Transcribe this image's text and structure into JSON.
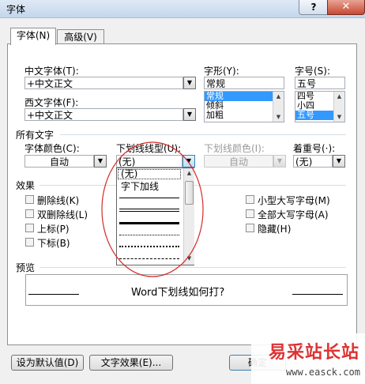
{
  "window": {
    "title": "字体",
    "help_label": "?",
    "close_label": "✕"
  },
  "tabs": [
    {
      "label": "字体(N)"
    },
    {
      "label": "高级(V)"
    }
  ],
  "font": {
    "chinese_label": "中文字体(T):",
    "chinese_value": "+中文正文",
    "western_label": "西文字体(F):",
    "western_value": "+中文正文",
    "style_label": "字形(Y):",
    "style_value": "常规",
    "style_options": [
      "常规",
      "倾斜",
      "加粗"
    ],
    "size_label": "字号(S):",
    "size_value": "五号",
    "size_options": [
      "四号",
      "小四",
      "五号"
    ]
  },
  "all_text": {
    "section_label": "所有文字",
    "color_label": "字体颜色(C):",
    "color_value": "自动",
    "underline_label": "下划线线型(U):",
    "underline_value": "(无)",
    "underline_color_label": "下划线颜色(I):",
    "underline_color_value": "自动",
    "emphasis_label": "着重号(·):",
    "emphasis_value": "(无)"
  },
  "underline_dropdown": {
    "items": [
      "(无)",
      "字下加线"
    ]
  },
  "effects": {
    "section_label": "效果",
    "left": [
      "删除线(K)",
      "双删除线(L)",
      "上标(P)",
      "下标(B)"
    ],
    "right": [
      "小型大写字母(M)",
      "全部大写字母(A)",
      "隐藏(H)"
    ]
  },
  "preview": {
    "section_label": "预览",
    "sample_text": "Word下划线如何打?"
  },
  "buttons": {
    "default_label": "设为默认值(D)",
    "text_effects_label": "文字效果(E)...",
    "ok_label": "确定"
  },
  "watermark": {
    "brand": "易采站长站",
    "url": "www.easck.com"
  },
  "colors": {
    "selection": "#3399ff",
    "annotation_circle": "#d42a2a",
    "watermark": "#d33333"
  }
}
